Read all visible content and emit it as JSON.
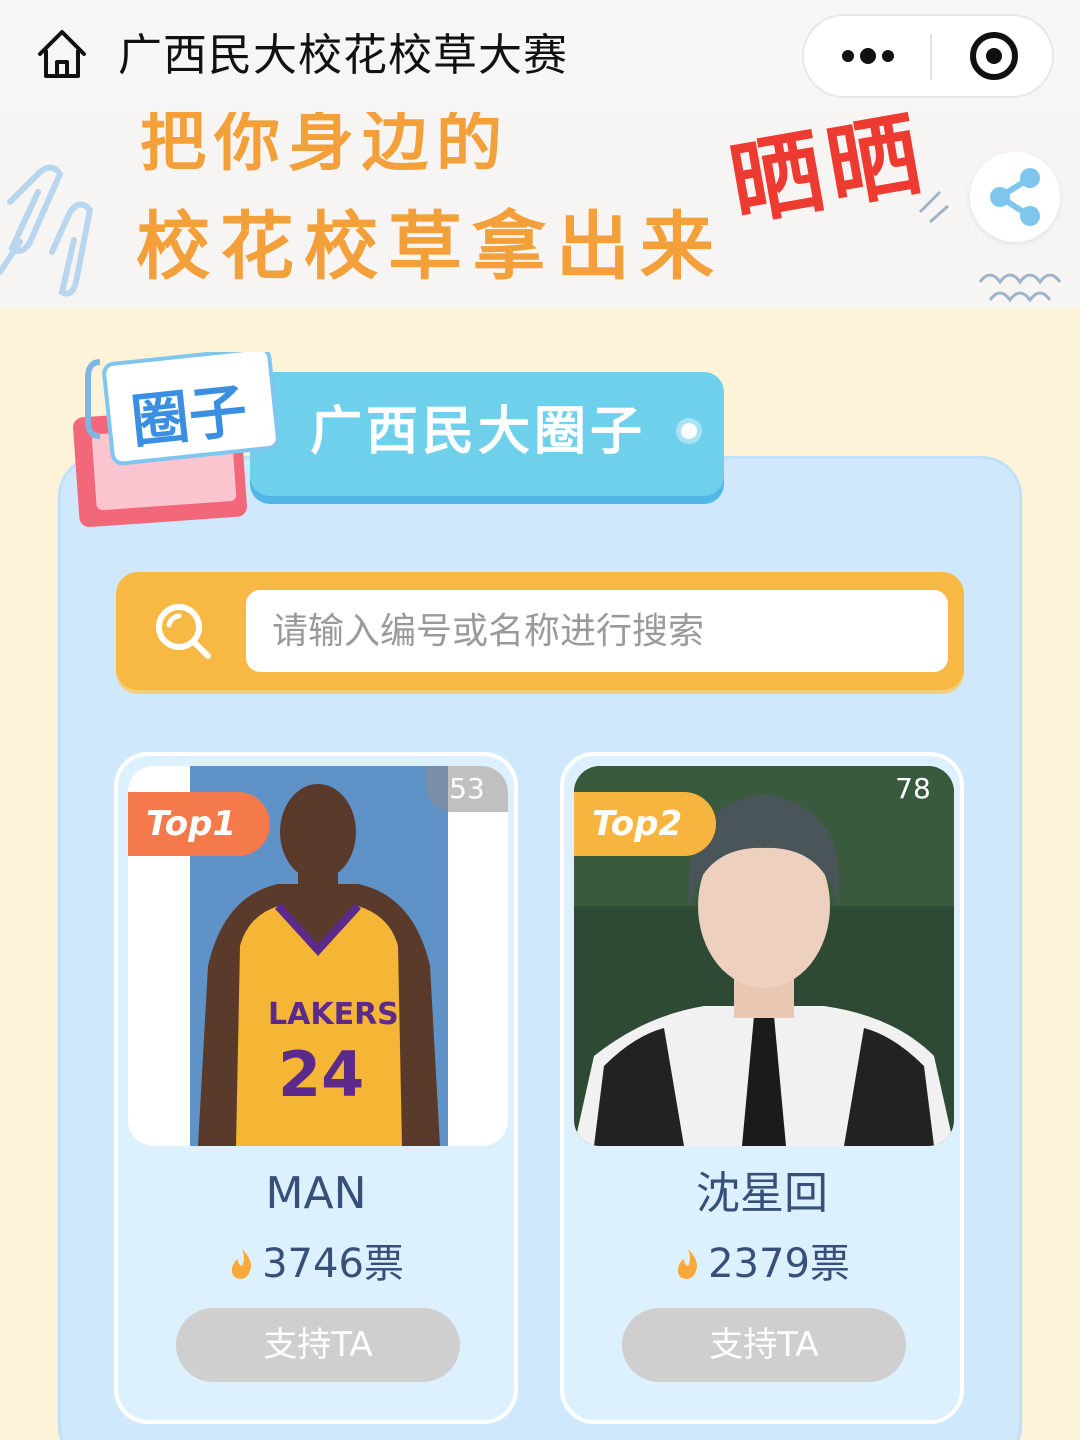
{
  "header": {
    "title": "广西民大校花校草大赛",
    "home_icon": "home-icon",
    "more_icon": "more-dots-icon",
    "close_icon": "target-close-icon"
  },
  "banner": {
    "line1": "把你身边的",
    "line2": "校花校草拿出来",
    "highlight": "晒晒",
    "share_icon": "share-icon"
  },
  "circle": {
    "badge_text": "圈子",
    "title": "广西民大圈子"
  },
  "search": {
    "placeholder": "请输入编号或名称进行搜索",
    "value": ""
  },
  "contestants": [
    {
      "rank": "Top1",
      "number": "53",
      "name": "MAN",
      "votes": "3746票",
      "button": "支持TA"
    },
    {
      "rank": "Top2",
      "number": "78",
      "name": "沈星回",
      "votes": "2379票",
      "button": "支持TA"
    }
  ],
  "colors": {
    "banner_orange": "#f3a03a",
    "banner_red": "#ee3b31",
    "panel_blue": "#cfe8fb",
    "header_cyan": "#6fd0ec",
    "search_yellow": "#f7b944",
    "top1": "#f47a4c",
    "top2": "#f7b53f"
  }
}
